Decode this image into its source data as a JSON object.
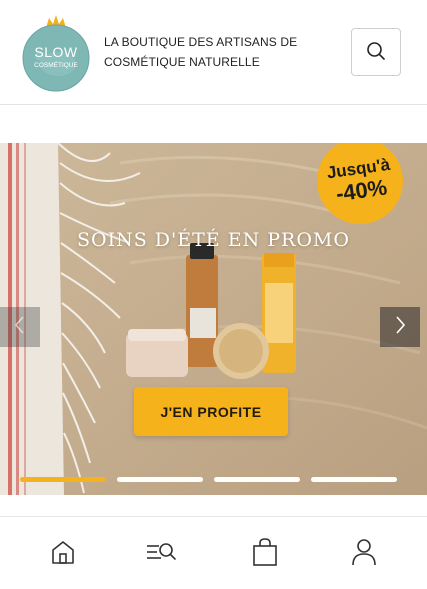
{
  "header": {
    "logo": {
      "brand_line1": "SLOW",
      "brand_line2": "COSMÉTIQUE",
      "icon": "turtle-logo"
    },
    "tagline_line1": "LA BOUTIQUE DES ARTISANS DE",
    "tagline_line2": "COSMÉTIQUE NATURELLE",
    "search_icon": "search-icon"
  },
  "banner": {
    "title": "SOINS D'ÉTÉ EN PROMO",
    "badge_line1": "Jusqu'à",
    "badge_line2": "-40%",
    "cta_label": "J'EN PROFITE",
    "prev_icon": "chevron-left-icon",
    "next_icon": "chevron-right-icon",
    "slide_count": 4,
    "active_slide": 1,
    "colors": {
      "badge": "#f6b21b",
      "cta": "#f6b21b",
      "active_dot": "#f4b21c"
    }
  },
  "bottom_nav": {
    "items": [
      {
        "icon": "home-icon"
      },
      {
        "icon": "menu-search-icon"
      },
      {
        "icon": "shopping-bag-icon"
      },
      {
        "icon": "user-icon"
      }
    ]
  }
}
